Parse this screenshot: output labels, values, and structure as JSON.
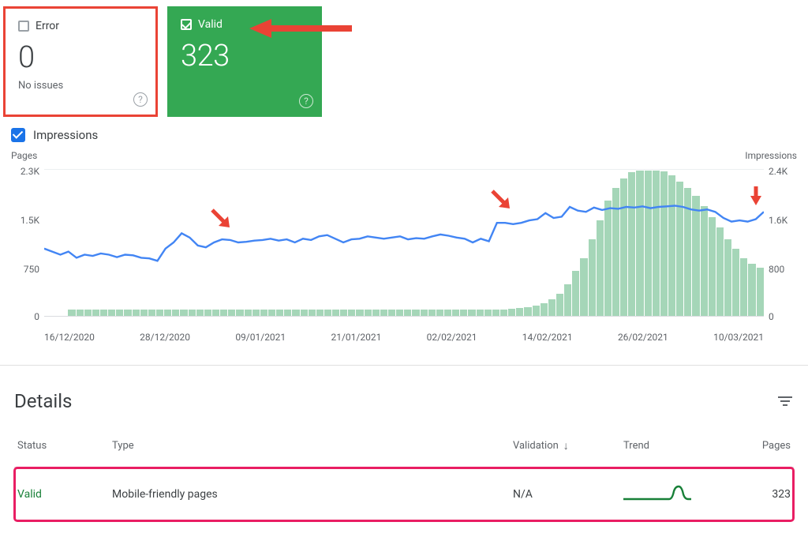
{
  "cards": {
    "error": {
      "label": "Error",
      "value": "0",
      "sub": "No issues"
    },
    "valid": {
      "label": "Valid",
      "value": "323"
    }
  },
  "impressions_toggle": {
    "label": "Impressions",
    "checked": true
  },
  "chart_data": {
    "type": "bar+line",
    "y_left_label": "Pages",
    "y_right_label": "Impressions",
    "y_left_ticks": [
      "2.3K",
      "1.5K",
      "750",
      "0"
    ],
    "y_right_ticks": [
      "2.4K",
      "1.6K",
      "800",
      "0"
    ],
    "ylim_pages": [
      0,
      2300
    ],
    "ylim_impressions": [
      0,
      2400
    ],
    "x_ticks": [
      "16/12/2020",
      "28/12/2020",
      "09/01/2021",
      "21/01/2021",
      "02/02/2021",
      "14/02/2021",
      "26/02/2021",
      "10/03/2021"
    ],
    "series": [
      {
        "name": "Impressions (line)",
        "axis": "right",
        "values": [
          1100,
          1050,
          1000,
          1050,
          950,
          1000,
          980,
          1020,
          1000,
          960,
          1000,
          990,
          950,
          940,
          900,
          1100,
          1200,
          1350,
          1280,
          1150,
          1120,
          1200,
          1250,
          1240,
          1200,
          1210,
          1230,
          1240,
          1260,
          1230,
          1250,
          1200,
          1260,
          1240,
          1300,
          1320,
          1260,
          1200,
          1250,
          1260,
          1300,
          1280,
          1260,
          1280,
          1300,
          1250,
          1270,
          1260,
          1300,
          1330,
          1310,
          1280,
          1260,
          1200,
          1260,
          1220,
          1520,
          1520,
          1500,
          1520,
          1560,
          1580,
          1680,
          1600,
          1620,
          1780,
          1720,
          1700,
          1770,
          1730,
          1760,
          1750,
          1780,
          1770,
          1790,
          1760,
          1780,
          1790,
          1800,
          1780,
          1740,
          1720,
          1740,
          1700,
          1600,
          1540,
          1560,
          1540,
          1580,
          1700
        ]
      },
      {
        "name": "Pages (bars)",
        "axis": "left",
        "values": [
          0,
          0,
          0,
          95,
          95,
          95,
          95,
          95,
          95,
          95,
          95,
          95,
          95,
          95,
          95,
          95,
          95,
          95,
          95,
          95,
          95,
          95,
          95,
          95,
          95,
          95,
          95,
          95,
          95,
          95,
          95,
          95,
          95,
          95,
          95,
          95,
          95,
          95,
          95,
          95,
          95,
          95,
          95,
          95,
          95,
          95,
          95,
          95,
          95,
          95,
          95,
          95,
          95,
          95,
          95,
          100,
          100,
          100,
          110,
          120,
          140,
          160,
          200,
          260,
          350,
          500,
          700,
          900,
          1200,
          1500,
          1800,
          2000,
          2150,
          2250,
          2280,
          2280,
          2280,
          2260,
          2200,
          2100,
          2000,
          1880,
          1720,
          1550,
          1380,
          1200,
          1050,
          900,
          820,
          760
        ]
      }
    ]
  },
  "details": {
    "title": "Details",
    "columns": {
      "status": "Status",
      "type": "Type",
      "validation": "Validation",
      "trend": "Trend",
      "pages": "Pages"
    },
    "rows": [
      {
        "status": "Valid",
        "type": "Mobile-friendly pages",
        "validation": "N/A",
        "pages": "323"
      }
    ]
  }
}
